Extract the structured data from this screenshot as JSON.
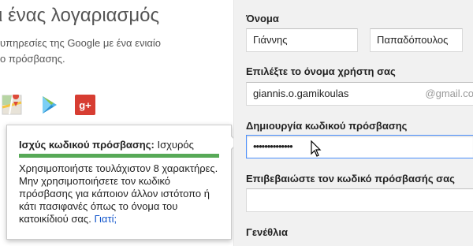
{
  "intro": {
    "headline": "ι ένας λογαριασμός",
    "line1": "υπηρεσίες της Google με ένα ενιαίο",
    "line2": "ο πρόσβασης."
  },
  "apps": [
    {
      "icon": "maps-icon"
    },
    {
      "icon": "play-store-icon"
    },
    {
      "icon": "google-plus-icon",
      "glyph": "g+"
    }
  ],
  "form": {
    "name_label": "Όνομα",
    "first_name": "Γιάννης",
    "last_name": "Παπαδόπουλος",
    "username_label": "Επιλέξτε το όνομα χρήστη σας",
    "username_value": "giannis.o.gamikoulas",
    "username_suffix": "@gmail.co",
    "password_label": "Δημιουργία κωδικού πρόσβασης",
    "password_value": "••••••••••••••",
    "confirm_label": "Επιβεβαιώστε τον κωδικό πρόσβασής σας",
    "confirm_value": "",
    "birthday_label": "Γενέθλια"
  },
  "tooltip": {
    "strength_label": "Ισχύς κωδικού πρόσβασης:",
    "strength_value": "Ισχυρός",
    "strength_level": 1.0,
    "tip_text": "Χρησιμοποιήστε τουλάχιστον 8 χαρακτήρες. Μην χρησιμοποιήσετε τον κωδικό πρόσβασης για κάποιον άλλον ιστότοπο ή κάτι πασιφανές όπως το όνομα του κατοικίδιού σας.",
    "why_link": "Γιατί;"
  },
  "colors": {
    "strength_bar": "#57a957",
    "focus_border": "#4d90fe",
    "link": "#1155cc",
    "form_bg": "#f1f1f1"
  }
}
